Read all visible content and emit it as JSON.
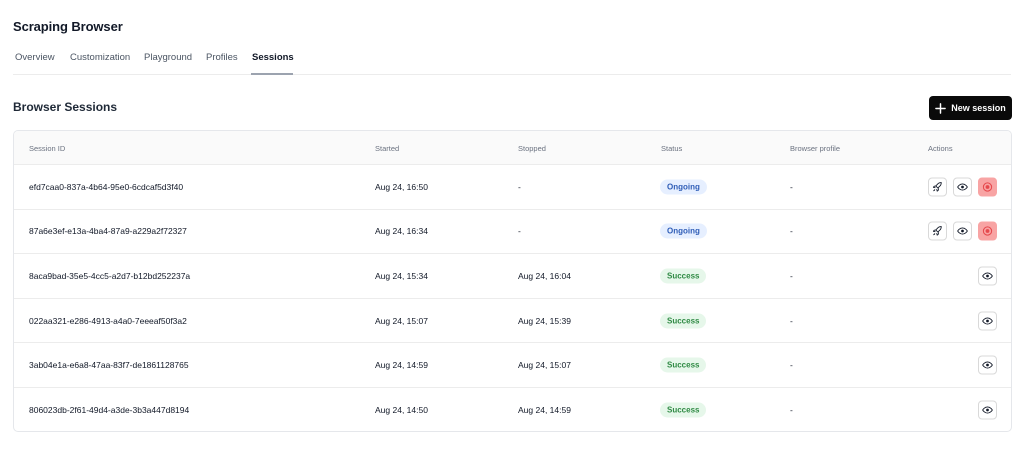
{
  "app": {
    "title": "Scraping Browser"
  },
  "tabs": [
    {
      "label": "Overview",
      "active": false
    },
    {
      "label": "Customization",
      "active": false
    },
    {
      "label": "Playground",
      "active": false
    },
    {
      "label": "Profiles",
      "active": false
    },
    {
      "label": "Sessions",
      "active": true
    }
  ],
  "section": {
    "title": "Browser Sessions",
    "new_button_label": "New session"
  },
  "table": {
    "headers": {
      "session_id": "Session ID",
      "started": "Started",
      "stopped": "Stopped",
      "status": "Status",
      "browser_profile": "Browser profile",
      "actions": "Actions"
    },
    "rows": [
      {
        "id": "efd7caa0-837a-4b64-95e0-6cdcaf5d3f40",
        "started": "Aug 24, 16:50",
        "stopped": "-",
        "status": "Ongoing",
        "profile": "-"
      },
      {
        "id": "87a6e3ef-e13a-4ba4-87a9-a229a2f72327",
        "started": "Aug 24, 16:34",
        "stopped": "-",
        "status": "Ongoing",
        "profile": "-"
      },
      {
        "id": "8aca9bad-35e5-4cc5-a2d7-b12bd252237a",
        "started": "Aug 24, 15:34",
        "stopped": "Aug 24, 16:04",
        "status": "Success",
        "profile": "-"
      },
      {
        "id": "022aa321-e286-4913-a4a0-7eeeaf50f3a2",
        "started": "Aug 24, 15:07",
        "stopped": "Aug 24, 15:39",
        "status": "Success",
        "profile": "-"
      },
      {
        "id": "3ab04e1a-e6a8-47aa-83f7-de1861128765",
        "started": "Aug 24, 14:59",
        "stopped": "Aug 24, 15:07",
        "status": "Success",
        "profile": "-"
      },
      {
        "id": "806023db-2f61-49d4-a3de-3b3a447d8194",
        "started": "Aug 24, 14:50",
        "stopped": "Aug 24, 14:59",
        "status": "Success",
        "profile": "-"
      }
    ]
  },
  "icons": {
    "new": "plus-icon",
    "launch": "rocket-icon",
    "view": "eye-icon",
    "stop": "stop-record-icon"
  },
  "colors": {
    "button_bg": "#0a0a0a",
    "ongoing_bg": "#e6efff",
    "ongoing_text": "#2f5db7",
    "success_bg": "#e6f7ea",
    "success_text": "#2f8a44",
    "stop_bg": "#f8a4a4",
    "stop_icon": "#e5484d"
  }
}
